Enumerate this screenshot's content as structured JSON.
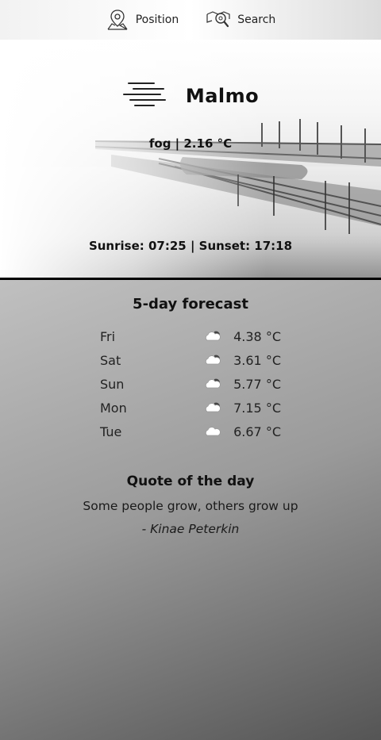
{
  "nav": {
    "position_label": "Position",
    "search_label": "Search",
    "position_icon": "map-pin-icon",
    "search_icon": "search-map-icon"
  },
  "weather": {
    "city": "Malmo",
    "condition_icon": "fog-icon",
    "condition_line": "fog | 2.16 °C",
    "sun_line": "Sunrise: 07:25 |  Sunset: 17:18"
  },
  "forecast": {
    "title": "5-day forecast",
    "days": [
      {
        "day": "Fri",
        "icon": "cloudy-icon",
        "temp": "4.38 °C"
      },
      {
        "day": "Sat",
        "icon": "cloudy-icon",
        "temp": "3.61 °C"
      },
      {
        "day": "Sun",
        "icon": "cloudy-icon",
        "temp": "5.77 °C"
      },
      {
        "day": "Mon",
        "icon": "cloudy-icon",
        "temp": "7.15 °C"
      },
      {
        "day": "Tue",
        "icon": "cloud-icon",
        "temp": "6.67 °C"
      }
    ]
  },
  "quote": {
    "title": "Quote of the day",
    "text": "Some people grow, others grow up",
    "author": "- Kinae Peterkin"
  },
  "colors": {
    "text": "#111111",
    "divider": "#000000"
  }
}
